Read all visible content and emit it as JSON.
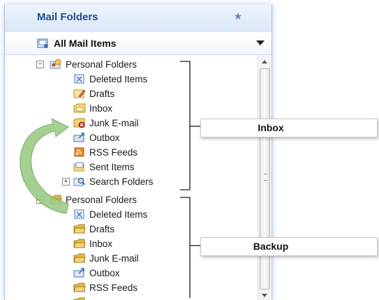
{
  "pane": {
    "title": "Mail Folders",
    "view_label": "All Mail Items"
  },
  "folders": [
    {
      "label": "Personal Folders",
      "icon": "personal-folders-icon"
    },
    {
      "label": "Deleted Items",
      "icon": "deleted-items-icon"
    },
    {
      "label": "Drafts",
      "icon": "drafts-icon"
    },
    {
      "label": "Inbox",
      "icon": "inbox-icon"
    },
    {
      "label": "Junk E-mail",
      "icon": "junk-email-icon"
    },
    {
      "label": "Outbox",
      "icon": "outbox-icon"
    },
    {
      "label": "RSS Feeds",
      "icon": "rss-feeds-icon"
    },
    {
      "label": "Sent Items",
      "icon": "sent-items-icon"
    },
    {
      "label": "Search Folders",
      "icon": "search-folders-icon"
    },
    {
      "label": "Personal Folders",
      "icon": "folder-icon"
    },
    {
      "label": "Deleted Items",
      "icon": "deleted-items-icon"
    },
    {
      "label": "Drafts",
      "icon": "folder-icon"
    },
    {
      "label": "Inbox",
      "icon": "folder-icon"
    },
    {
      "label": "Junk E-mail",
      "icon": "folder-icon"
    },
    {
      "label": "Outbox",
      "icon": "outbox-icon"
    },
    {
      "label": "RSS Feeds",
      "icon": "folder-icon"
    }
  ],
  "callouts": {
    "first": "Inbox",
    "second": "Backup"
  },
  "colors": {
    "header_text": "#1f4e8c",
    "arrow": "#7fb069",
    "folder": "#e9b84a"
  }
}
